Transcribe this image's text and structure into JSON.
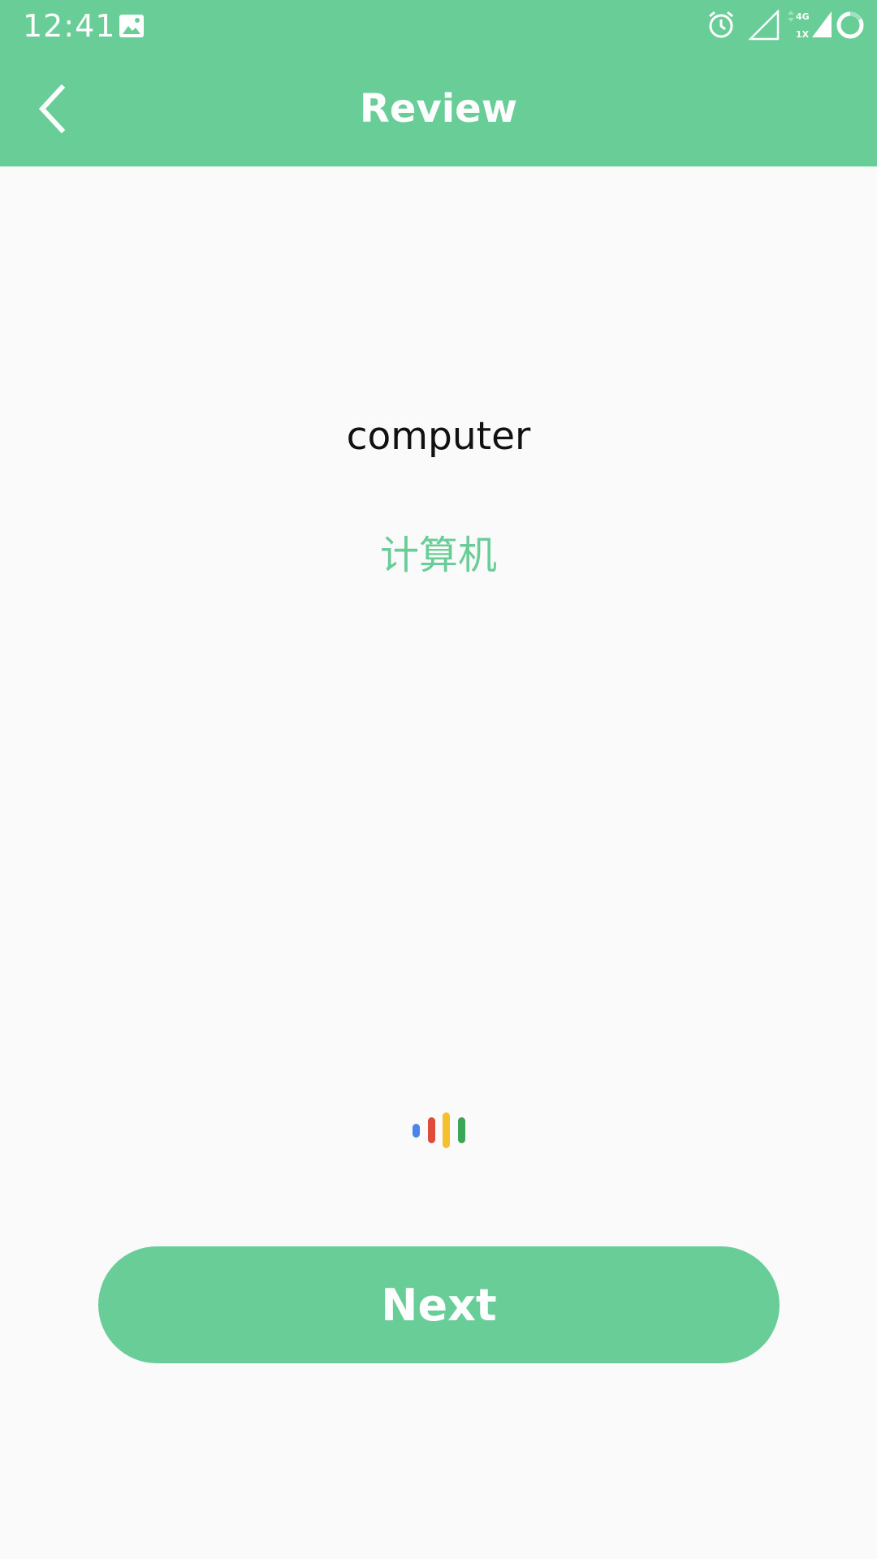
{
  "status_bar": {
    "time": "12:41",
    "icons": [
      "gallery-icon",
      "alarm-icon",
      "signal-outline-icon",
      "network-4g-1x-icon",
      "signal-full-icon",
      "loading-ring-icon"
    ],
    "network_top": "4G",
    "network_bottom": "1X"
  },
  "app_bar": {
    "title": "Review",
    "back_icon": "chevron-left-icon"
  },
  "card": {
    "word": "computer",
    "translation": "计算机"
  },
  "voice_indicator": {
    "icon": "voice-bars-icon",
    "colors": [
      "#4a86e8",
      "#e04c3c",
      "#f6c02b",
      "#3aa757"
    ]
  },
  "next_button": {
    "label": "Next"
  },
  "colors": {
    "accent": "#69cd98",
    "background": "#fafafa",
    "text": "#111111"
  }
}
